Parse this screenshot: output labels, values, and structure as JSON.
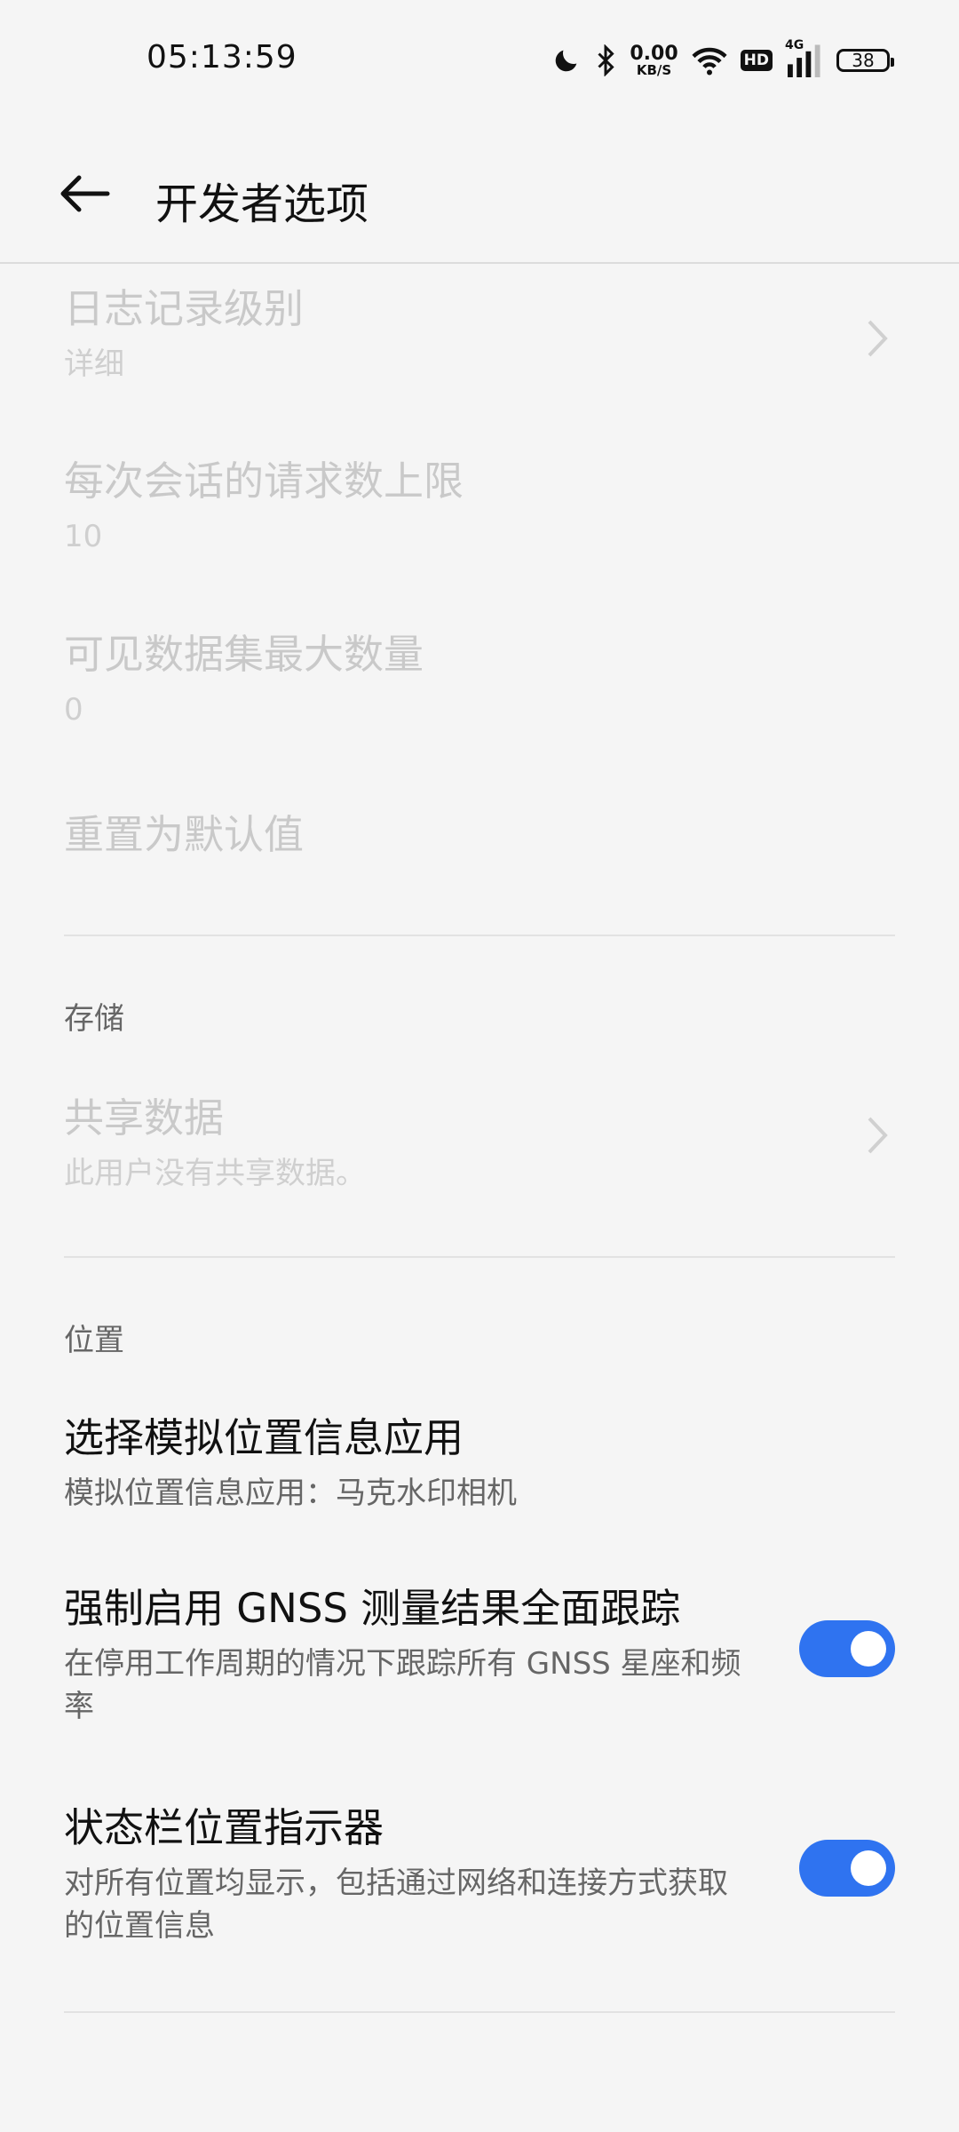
{
  "status_bar": {
    "time": "05:13:59",
    "net_speed_value": "0.00",
    "net_speed_unit": "KB/S",
    "hd_label": "HD",
    "signal_label": "4G",
    "battery_level": "38",
    "icons": [
      "moon-icon",
      "bluetooth-icon",
      "wifi-icon",
      "hd-icon",
      "signal-icon",
      "battery-icon"
    ]
  },
  "app_bar": {
    "title": "开发者选项",
    "back_icon": "arrow-left-icon"
  },
  "items_top": [
    {
      "title": "日志记录级别",
      "subtitle": "详细",
      "disabled": true,
      "chevron": true
    },
    {
      "title": "每次会话的请求数上限",
      "subtitle": "10",
      "disabled": true
    },
    {
      "title": "可见数据集最大数量",
      "subtitle": "0",
      "disabled": true
    },
    {
      "title": "重置为默认值",
      "disabled": true
    }
  ],
  "storage": {
    "header": "存储",
    "items": [
      {
        "title": "共享数据",
        "subtitle": "此用户没有共享数据。",
        "disabled": true,
        "chevron": true
      }
    ]
  },
  "location": {
    "header": "位置",
    "items": [
      {
        "title": "选择模拟位置信息应用",
        "subtitle": "模拟位置信息应用：马克水印相机"
      },
      {
        "title": "强制启用 GNSS 测量结果全面跟踪",
        "subtitle": "在停用工作周期的情况下跟踪所有 GNSS 星座和频率",
        "toggle_on": true
      },
      {
        "title": "状态栏位置指示器",
        "subtitle": "对所有位置均显示，包括通过网络和连接方式获取的位置信息",
        "toggle_on": true
      }
    ]
  },
  "colors": {
    "toggle_on": "#2f73f0",
    "background": "#f5f5f5",
    "disabled_text": "#c9c9c9"
  }
}
